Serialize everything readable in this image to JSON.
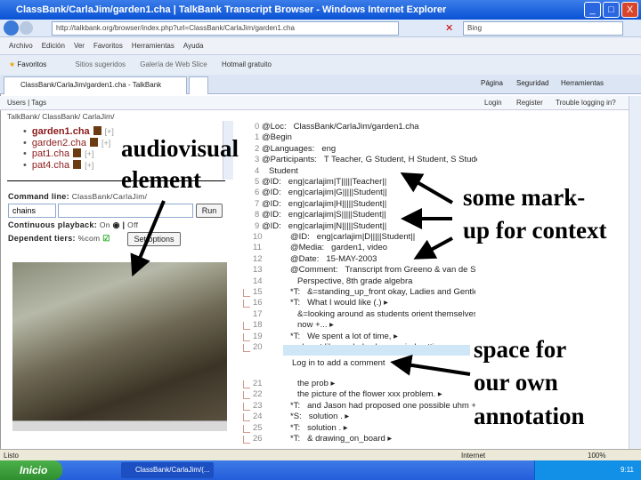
{
  "window": {
    "title": "ClassBank/CarlaJim/garden1.cha | TalkBank Transcript Browser - Windows Internet Explorer",
    "minimize": "_",
    "maximize": "□",
    "close": "X"
  },
  "address": {
    "url": "http://talkbank.org/browser/index.php?url=ClassBank/CarlaJim/garden1.cha",
    "search_value": "Bing"
  },
  "menu": [
    "Archivo",
    "Edición",
    "Ver",
    "Favoritos",
    "Herramientas",
    "Ayuda"
  ],
  "favorites": {
    "label": "Favoritos",
    "items": [
      "Sitios sugeridos",
      "Galería de Web Slice",
      "Hotmail gratuito"
    ]
  },
  "tabs": {
    "active": "ClassBank/CarlaJim/garden1.cha - TalkBank Transcrip...",
    "tools": [
      "Página",
      "Seguridad",
      "Herramientas"
    ]
  },
  "userbar": {
    "left": "Users | Tags",
    "login": "Login",
    "register": "Register",
    "trouble": "Trouble logging in?"
  },
  "left": {
    "breadcrumb": "TalkBank/ ClassBank/ CarlaJim/",
    "files": [
      {
        "name": "garden1.cha",
        "active": true
      },
      {
        "name": "garden2.cha"
      },
      {
        "name": "pat1.cha"
      },
      {
        "name": "pat4.cha"
      }
    ],
    "expand": "[+]",
    "command_label": "Command line:",
    "command_value": "ClassBank/CarlaJim/",
    "select_value": "chains",
    "run": "Run",
    "playback_label": "Continuous playback:",
    "on": "On",
    "off": "Off",
    "tiers_label": "Dependent tiers:",
    "tiers_value": "%com",
    "options": "Set options"
  },
  "transcript": [
    {
      "n": "0",
      "s": "@Loc:",
      "t": "ClassBank/CarlaJim/garden1.cha"
    },
    {
      "n": "1",
      "s": "@Begin",
      "t": ""
    },
    {
      "n": "2",
      "s": "@Languages:",
      "t": "eng"
    },
    {
      "n": "3",
      "s": "@Participants:",
      "t": "T Teacher, G Student, H Student, S Student, N Student, D"
    },
    {
      "n": "4",
      "s": "",
      "t": "Student"
    },
    {
      "n": "5",
      "s": "@ID:",
      "t": "eng|carlajim|T|||||Teacher||"
    },
    {
      "n": "6",
      "s": "@ID:",
      "t": "eng|carlajim|G|||||Student||"
    },
    {
      "n": "7",
      "s": "@ID:",
      "t": "eng|carlajim|H|||||Student||"
    },
    {
      "n": "8",
      "s": "@ID:",
      "t": "eng|carlajim|S|||||Student||"
    },
    {
      "n": "9",
      "s": "@ID:",
      "t": "eng|carlajim|N|||||Student||"
    },
    {
      "n": "10",
      "s": "@ID:",
      "t": "eng|carlajim|D|||||Student||"
    },
    {
      "n": "11",
      "s": "@Media:",
      "t": "garden1, video"
    },
    {
      "n": "12",
      "s": "@Date:",
      "t": "15-MAY-2003"
    },
    {
      "n": "13",
      "s": "@Comment:",
      "t": "Transcript from Greeno & van de Sande, Garden Log Problem"
    },
    {
      "n": "14",
      "s": "",
      "t": "Perspective, 8th grade algebra"
    },
    {
      "n": "15",
      "s": "*T:",
      "t": "&=standing_up_front okay, Ladies and Gentlemen. ▸"
    },
    {
      "n": "16",
      "s": "*T:",
      "t": "What I would like (.) ▸"
    },
    {
      "n": "17",
      "s": "",
      "t": "&=looking around as students orient themselves for us to do right"
    },
    {
      "n": "18",
      "s": "",
      "t": "now +... ▸"
    },
    {
      "n": "19",
      "s": "*T:",
      "t": "We spent a lot of time, ▸"
    },
    {
      "n": "20",
      "s": "",
      "t": "almost like a whole class period setting up ▸"
    },
    {
      "n": "21",
      "s": "",
      "t": "the prob ▸"
    },
    {
      "n": "22",
      "s": "",
      "t": "the picture of the flower xxx problem. ▸"
    },
    {
      "n": "23",
      "s": "*T:",
      "t": "and Jason had proposed one possible uhm +/. ▸"
    },
    {
      "n": "24",
      "s": "*S:",
      "t": "solution . ▸"
    },
    {
      "n": "25",
      "s": "*T:",
      "t": "solution . ▸"
    },
    {
      "n": "26",
      "s": "*T:",
      "t": "& drawing_on_board ▸"
    }
  ],
  "comment_prompt": "Log in to add a comment",
  "status": {
    "left": "Listo",
    "zone": "Internet",
    "zoom": "100%"
  },
  "taskbar": {
    "start": "Inicio",
    "window": "ClassBank/CarlaJim/(...",
    "clock": "9:11"
  },
  "annotations": {
    "av1": "audiovisual",
    "av2": "element",
    "ctx1": "some mark-",
    "ctx2": "up for context",
    "an1": "space for",
    "an2": "our own",
    "an3": "annotation"
  },
  "colors": {
    "titlebar": "#0a52d6",
    "highlight": "#cfe6f7",
    "file_active": "#8b1a1a"
  }
}
